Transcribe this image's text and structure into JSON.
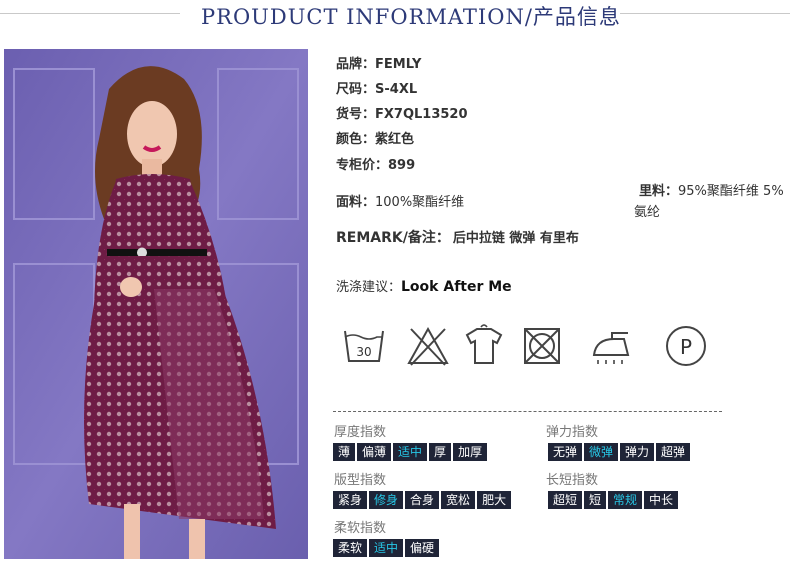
{
  "header": {
    "title": "PROUDUCT INFORMATION/产品信息"
  },
  "specs": {
    "brand": {
      "label": "品牌：",
      "value": "FEMLY"
    },
    "size": {
      "label": "尺码：",
      "value": "S-4XL"
    },
    "sku": {
      "label": "货号：",
      "value": "FX7QL13520"
    },
    "color": {
      "label": "颜色：",
      "value": "紫红色"
    },
    "price": {
      "label": "专柜价：",
      "value": "899"
    },
    "fabric": {
      "label": "面料：",
      "value": "100%聚酯纤维"
    },
    "lining": {
      "label": "里料：",
      "value": "95%聚酯纤维 5%",
      "value2": "氨纶"
    },
    "remark": {
      "label": "REMARK/备注：",
      "value": "后中拉链 微弹 有里布"
    }
  },
  "care": {
    "label": "洗涤建议：",
    "title": "Look After Me",
    "icons": [
      {
        "name": "wash-30-icon",
        "text": "30"
      },
      {
        "name": "no-bleach-icon"
      },
      {
        "name": "hang-dry-icon"
      },
      {
        "name": "no-tumble-dry-icon"
      },
      {
        "name": "iron-icon"
      },
      {
        "name": "dry-clean-p-icon",
        "text": "P"
      }
    ]
  },
  "indices": {
    "thickness": {
      "label": "厚度指数",
      "options": [
        "薄",
        "偏薄",
        "适中",
        "厚",
        "加厚"
      ],
      "selected": 2
    },
    "elasticity": {
      "label": "弹力指数",
      "options": [
        "无弹",
        "微弹",
        "弹力",
        "超弹"
      ],
      "selected": 1
    },
    "fit": {
      "label": "版型指数",
      "options": [
        "紧身",
        "修身",
        "合身",
        "宽松",
        "肥大"
      ],
      "selected": 1
    },
    "length": {
      "label": "长短指数",
      "options": [
        "超短",
        "短",
        "常规",
        "中长"
      ],
      "selected": 2
    },
    "softness": {
      "label": "柔软指数",
      "options": [
        "柔软",
        "适中",
        "偏硬"
      ],
      "selected": 1
    }
  },
  "colors": {
    "title": "#2d3a78",
    "chip_bg": "#1f2437",
    "chip_active_text": "#27c7e6",
    "photo_bg": "#7a6fb6",
    "dress": "#6e1c45"
  }
}
